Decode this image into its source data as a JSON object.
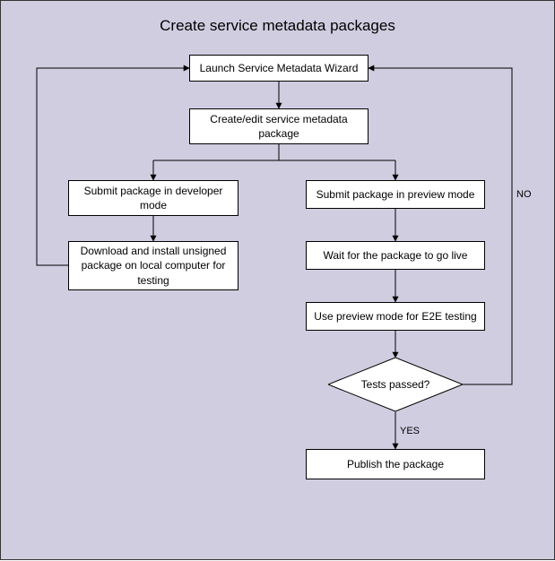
{
  "title": "Create service metadata packages",
  "nodes": {
    "launch": "Launch Service Metadata Wizard",
    "create_edit": "Create/edit service metadata package",
    "submit_dev": "Submit package in developer mode",
    "download_install": "Download and install unsigned package on local computer for testing",
    "submit_preview": "Submit package in preview mode",
    "wait_live": "Wait for the package to go live",
    "use_preview": "Use preview mode for E2E testing",
    "decision": "Tests passed?",
    "publish": "Publish the package"
  },
  "edges": {
    "no": "NO",
    "yes": "YES"
  },
  "chart_data": {
    "type": "flowchart",
    "title": "Create service metadata packages",
    "nodes": [
      {
        "id": "launch",
        "label": "Launch Service Metadata Wizard",
        "type": "process"
      },
      {
        "id": "create_edit",
        "label": "Create/edit service metadata package",
        "type": "process"
      },
      {
        "id": "submit_dev",
        "label": "Submit package in developer mode",
        "type": "process"
      },
      {
        "id": "download_install",
        "label": "Download and install unsigned package on local computer for testing",
        "type": "process"
      },
      {
        "id": "submit_preview",
        "label": "Submit package in preview mode",
        "type": "process"
      },
      {
        "id": "wait_live",
        "label": "Wait for the package to go live",
        "type": "process"
      },
      {
        "id": "use_preview",
        "label": "Use preview mode for E2E testing",
        "type": "process"
      },
      {
        "id": "decision",
        "label": "Tests passed?",
        "type": "decision"
      },
      {
        "id": "publish",
        "label": "Publish the package",
        "type": "process"
      }
    ],
    "edges": [
      {
        "from": "launch",
        "to": "create_edit"
      },
      {
        "from": "create_edit",
        "to": "submit_dev"
      },
      {
        "from": "create_edit",
        "to": "submit_preview"
      },
      {
        "from": "submit_dev",
        "to": "download_install"
      },
      {
        "from": "download_install",
        "to": "launch"
      },
      {
        "from": "submit_preview",
        "to": "wait_live"
      },
      {
        "from": "wait_live",
        "to": "use_preview"
      },
      {
        "from": "use_preview",
        "to": "decision"
      },
      {
        "from": "decision",
        "to": "publish",
        "label": "YES"
      },
      {
        "from": "decision",
        "to": "launch",
        "label": "NO"
      }
    ]
  }
}
